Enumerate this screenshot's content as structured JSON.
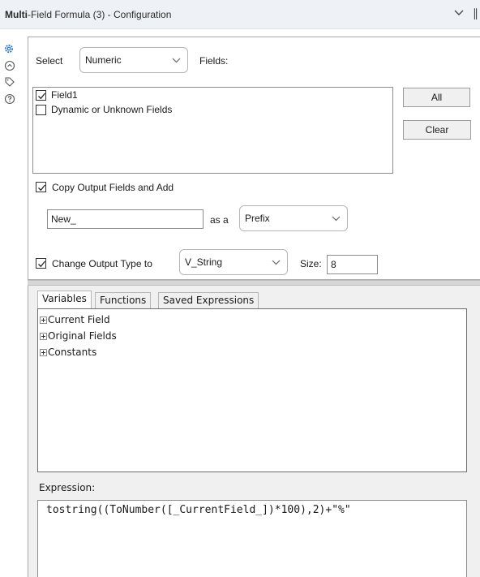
{
  "window": {
    "title_bold": "Multi",
    "title_rest": "-Field Formula (3) - Configuration",
    "pin_glyph": "∥"
  },
  "sidebar": {
    "icons": [
      "gear-icon",
      "tool-info-icon",
      "tag-icon",
      "help-icon"
    ],
    "accent": "#1a6fd8"
  },
  "config": {
    "select_label": "Select",
    "select_value": "Numeric",
    "fields_label": "Fields:",
    "field_items": [
      {
        "label": "Field1",
        "checked": true
      },
      {
        "label": "Dynamic or Unknown Fields",
        "checked": false
      }
    ],
    "all_button": "All",
    "clear_button": "Clear",
    "copy_output": {
      "label": "Copy Output Fields and Add",
      "checked": true
    },
    "name_value": "New_",
    "as_a_label": "as a",
    "position_value": "Prefix",
    "change_type": {
      "label": "Change Output Type to",
      "checked": true
    },
    "type_value": "V_String",
    "size_label": "Size:",
    "size_value": "8"
  },
  "editor": {
    "tabs": [
      "Variables",
      "Functions",
      "Saved Expressions"
    ],
    "active_tab": "Variables",
    "tree_items": [
      "Current Field",
      "Original Fields",
      "Constants"
    ],
    "expression_label": "Expression:",
    "expression": "tostring((ToNumber([_CurrentField_])*100),2)+\"%\""
  }
}
